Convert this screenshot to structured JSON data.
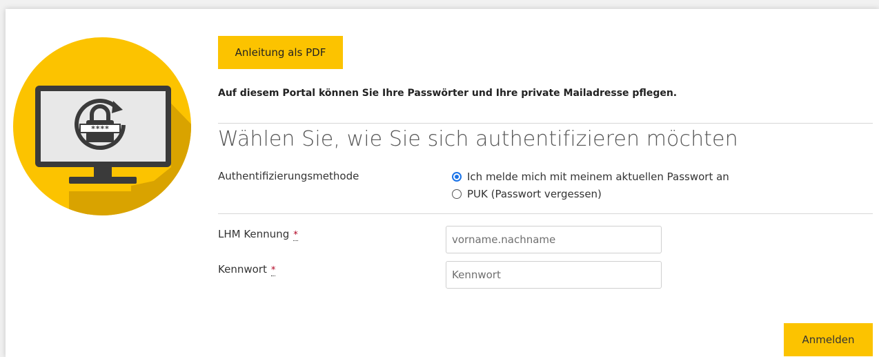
{
  "header": {
    "pdf_button_label": "Anleitung als PDF",
    "intro_text": "Auf diesem Portal können Sie Ihre Passwörter und Ihre private Mailadresse pflegen."
  },
  "auth": {
    "heading": "Wählen Sie, wie Sie sich authentifizieren möchten",
    "method_label": "Authentifizierungsmethode",
    "options": [
      {
        "label": "Ich melde mich mit meinem aktuellen Passwort an",
        "selected": true
      },
      {
        "label": "PUK (Passwort vergessen)",
        "selected": false
      }
    ]
  },
  "form": {
    "kennung_label": "LHM Kennung",
    "kennung_placeholder": "vorname.nachname",
    "kennung_value": "",
    "kennwort_label": "Kennwort",
    "kennwort_placeholder": "Kennwort",
    "kennwort_value": "",
    "required_marker": "*",
    "submit_label": "Anmelden"
  },
  "logo": {
    "masked_password": "****",
    "icon": "monitor-lock-refresh-icon"
  },
  "colors": {
    "accent": "#fcc300",
    "radio_selected": "#1a73e8",
    "required": "#b00020"
  }
}
